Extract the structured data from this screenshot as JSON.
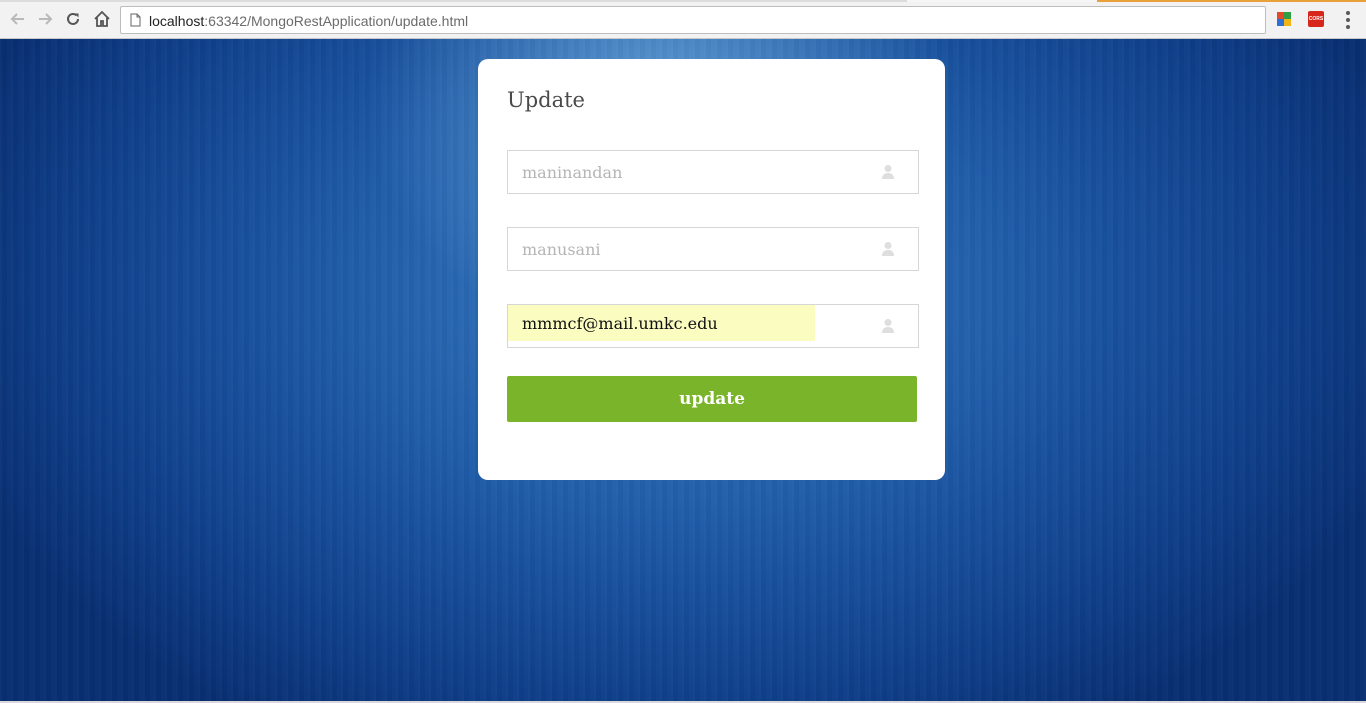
{
  "browser": {
    "url_host": "localhost",
    "url_rest": ":63342/MongoRestApplication/update.html",
    "nav_icons": [
      "back-arrow-icon",
      "forward-arrow-icon",
      "reload-icon",
      "home-icon"
    ],
    "extensions": [
      "colorful-extension-icon",
      "cors-extension-icon"
    ],
    "cors_label": "CORS"
  },
  "form": {
    "title": "Update",
    "fields": [
      {
        "value": "maninandan",
        "icon": "user-icon"
      },
      {
        "value": "manusani",
        "icon": "user-icon"
      },
      {
        "value": "mmmcf@mail.umkc.edu",
        "icon": "user-icon"
      }
    ],
    "submit_label": "update"
  },
  "colors": {
    "button": "#7ab42b",
    "autofill": "#fafcc0",
    "background": "#1f5ba8"
  }
}
